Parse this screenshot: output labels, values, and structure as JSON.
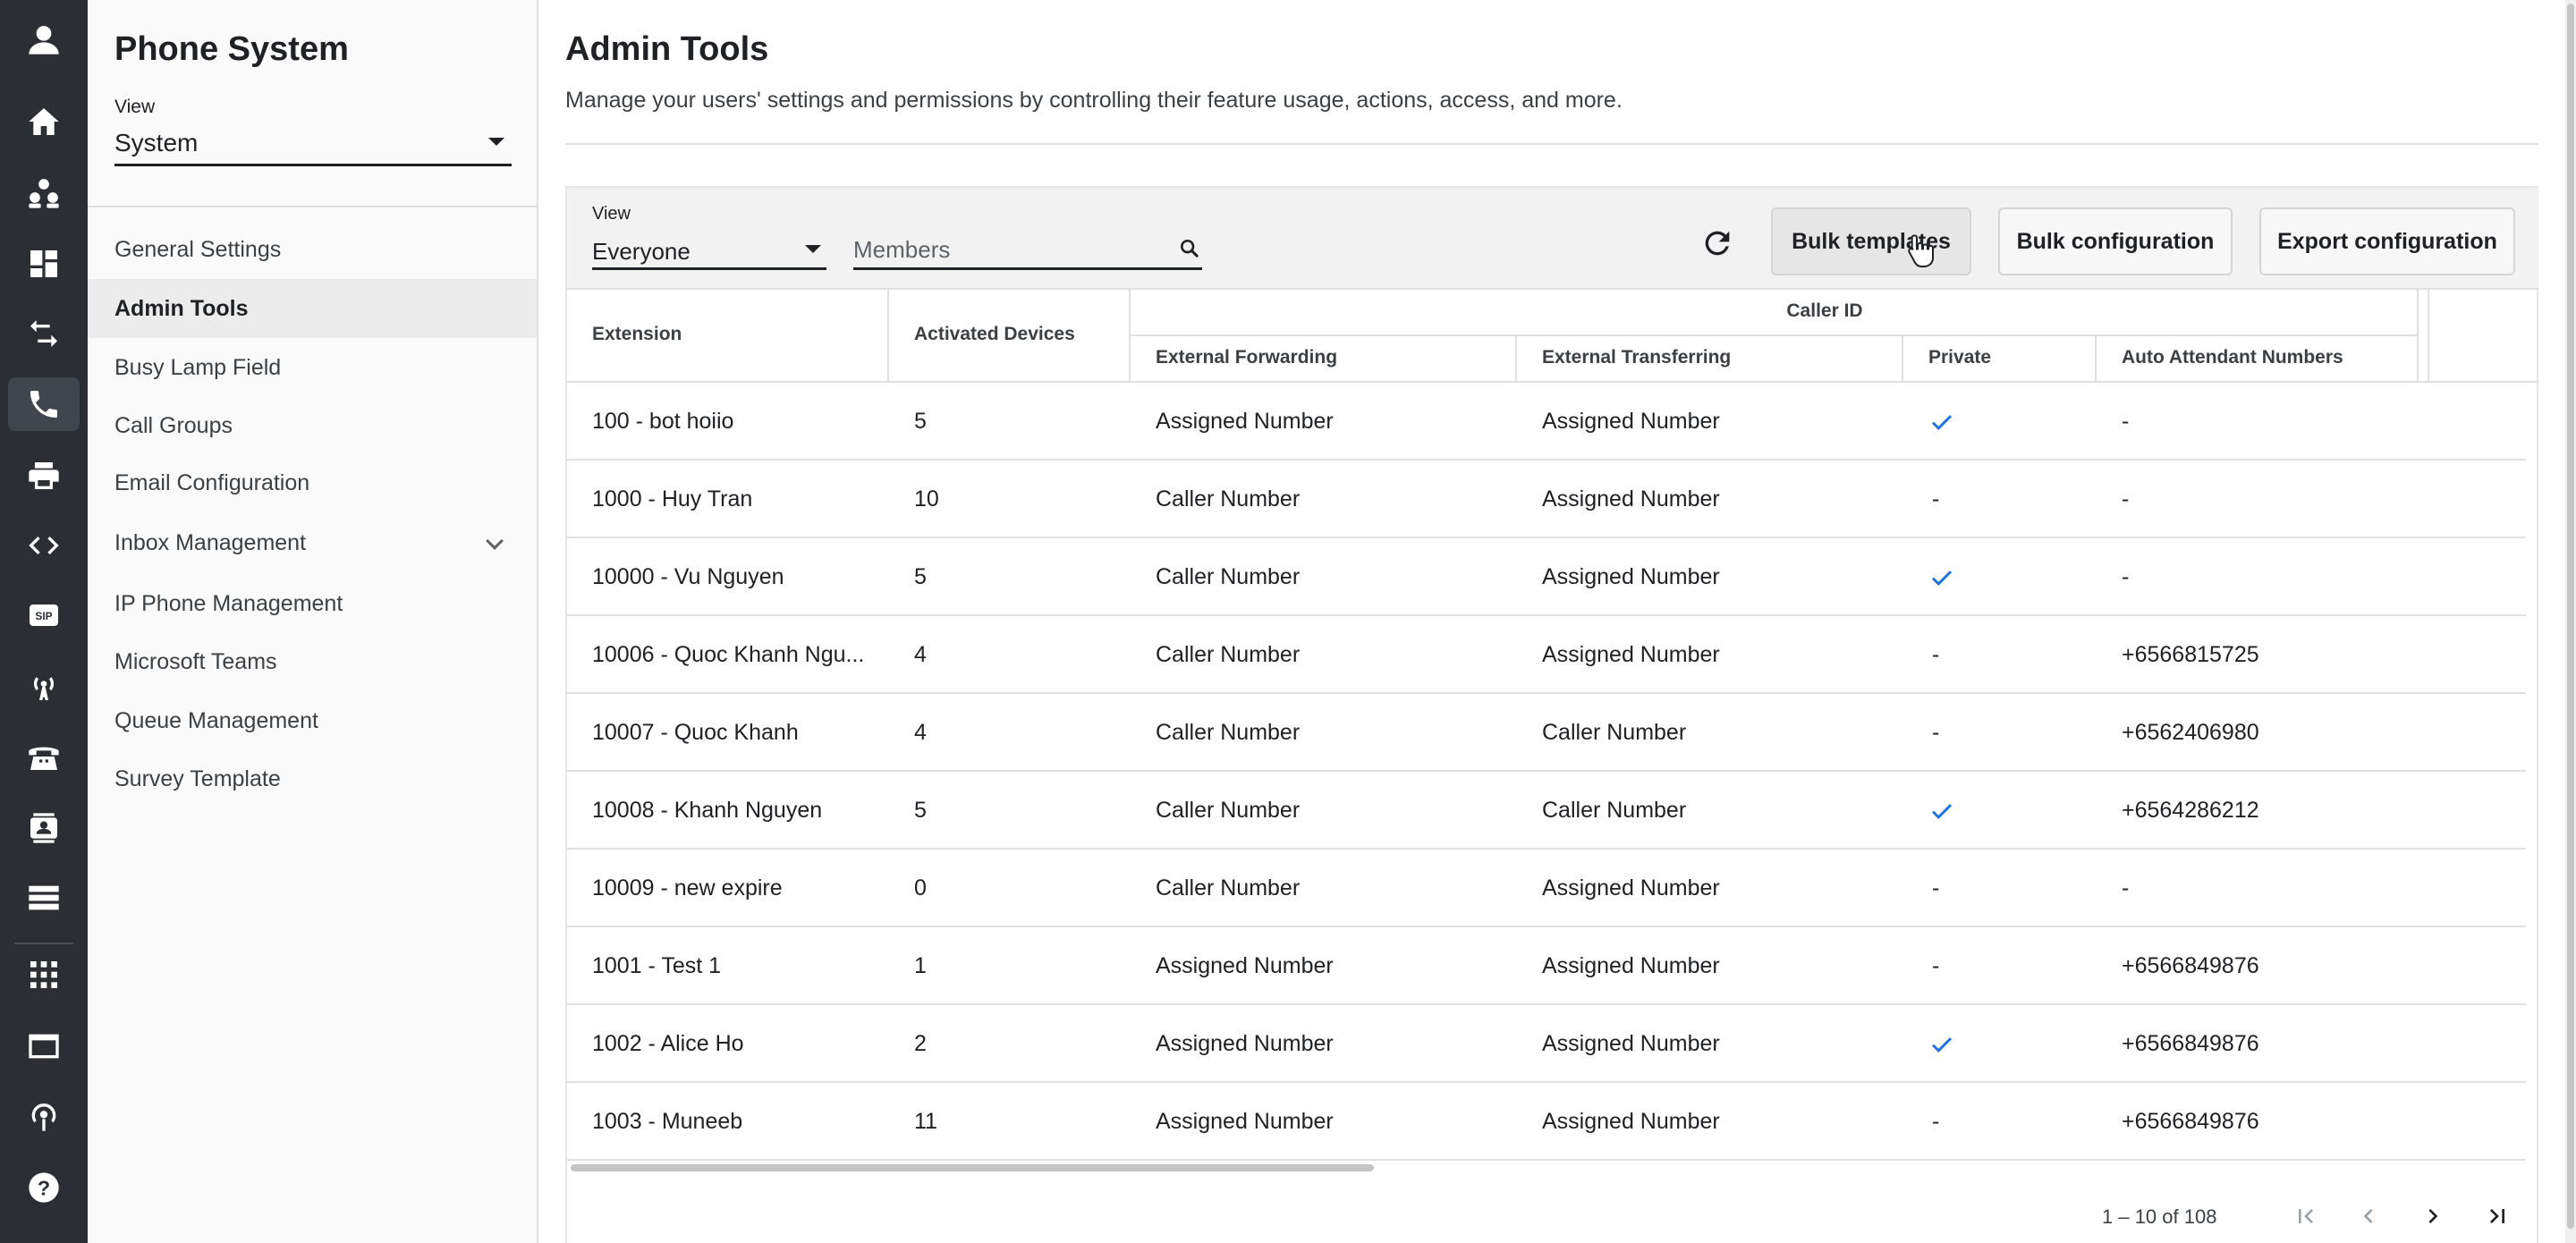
{
  "rail": {
    "icons": [
      "user-avatar-icon",
      "home-icon",
      "group-icon",
      "dashboard-icon",
      "swap-arrows-icon",
      "phone-icon",
      "printer-icon",
      "code-icon",
      "sip-icon",
      "antenna-icon",
      "desk-phone-icon",
      "contact-card-icon",
      "server-icon",
      "apps-grid-icon",
      "window-icon",
      "podcast-icon",
      "help-icon"
    ],
    "sip_label": "SIP",
    "help_label": "?"
  },
  "sidebar": {
    "title": "Phone System",
    "view_label": "View",
    "view_value": "System",
    "items": [
      {
        "label": "General Settings"
      },
      {
        "label": "Admin Tools"
      },
      {
        "label": "Busy Lamp Field"
      },
      {
        "label": "Call Groups"
      },
      {
        "label": "Email Configuration"
      },
      {
        "label": "Inbox Management"
      },
      {
        "label": "IP Phone Management"
      },
      {
        "label": "Microsoft Teams"
      },
      {
        "label": "Queue Management"
      },
      {
        "label": "Survey Template"
      }
    ],
    "active_item": "Admin Tools"
  },
  "main": {
    "title": "Admin Tools",
    "description": "Manage your users' settings and permissions by controlling their feature usage, actions, access, and more.",
    "toolbar": {
      "view_label": "View",
      "view_value": "Everyone",
      "search_placeholder": "Members",
      "bulk_templates": "Bulk templates",
      "bulk_configuration": "Bulk configuration",
      "export_configuration": "Export configuration"
    },
    "table": {
      "group_header": "Caller ID",
      "columns": {
        "extension": "Extension",
        "devices": "Activated Devices",
        "ext_forwarding": "External Forwarding",
        "ext_transferring": "External Transferring",
        "private": "Private",
        "aa_numbers": "Auto Attendant Numbers"
      },
      "rows": [
        {
          "extension": "100 - bot hoiio",
          "devices": "5",
          "ext_forwarding": "Assigned Number",
          "ext_transferring": "Assigned Number",
          "private": true,
          "aa_numbers": "-"
        },
        {
          "extension": "1000 - Huy Tran",
          "devices": "10",
          "ext_forwarding": "Caller Number",
          "ext_transferring": "Assigned Number",
          "private": false,
          "aa_numbers": "-"
        },
        {
          "extension": "10000 - Vu Nguyen",
          "devices": "5",
          "ext_forwarding": "Caller Number",
          "ext_transferring": "Assigned Number",
          "private": true,
          "aa_numbers": "-"
        },
        {
          "extension": "10006 - Quoc Khanh Ngu...",
          "devices": "4",
          "ext_forwarding": "Caller Number",
          "ext_transferring": "Assigned Number",
          "private": false,
          "aa_numbers": "+6566815725"
        },
        {
          "extension": "10007 - Quoc Khanh",
          "devices": "4",
          "ext_forwarding": "Caller Number",
          "ext_transferring": "Caller Number",
          "private": false,
          "aa_numbers": "+6562406980"
        },
        {
          "extension": "10008 - Khanh Nguyen",
          "devices": "5",
          "ext_forwarding": "Caller Number",
          "ext_transferring": "Caller Number",
          "private": true,
          "aa_numbers": "+6564286212"
        },
        {
          "extension": "10009 - new expire",
          "devices": "0",
          "ext_forwarding": "Caller Number",
          "ext_transferring": "Assigned Number",
          "private": false,
          "aa_numbers": "-"
        },
        {
          "extension": "1001 - Test 1",
          "devices": "1",
          "ext_forwarding": "Assigned Number",
          "ext_transferring": "Assigned Number",
          "private": false,
          "aa_numbers": "+6566849876"
        },
        {
          "extension": "1002 - Alice Ho",
          "devices": "2",
          "ext_forwarding": "Assigned Number",
          "ext_transferring": "Assigned Number",
          "private": true,
          "aa_numbers": "+6566849876"
        },
        {
          "extension": "1003 - Muneeb",
          "devices": "11",
          "ext_forwarding": "Assigned Number",
          "ext_transferring": "Assigned Number",
          "private": false,
          "aa_numbers": "+6566849876"
        }
      ],
      "private_false_text": "-"
    },
    "pagination": {
      "range_text": "1 – 10 of 108",
      "icons": [
        "first-page-icon",
        "previous-page-icon",
        "next-page-icon",
        "last-page-icon"
      ]
    }
  },
  "colors": {
    "rail_bg": "#2b2f33",
    "check_blue": "#1a73e8",
    "sidebar_bg": "#fafafa"
  }
}
